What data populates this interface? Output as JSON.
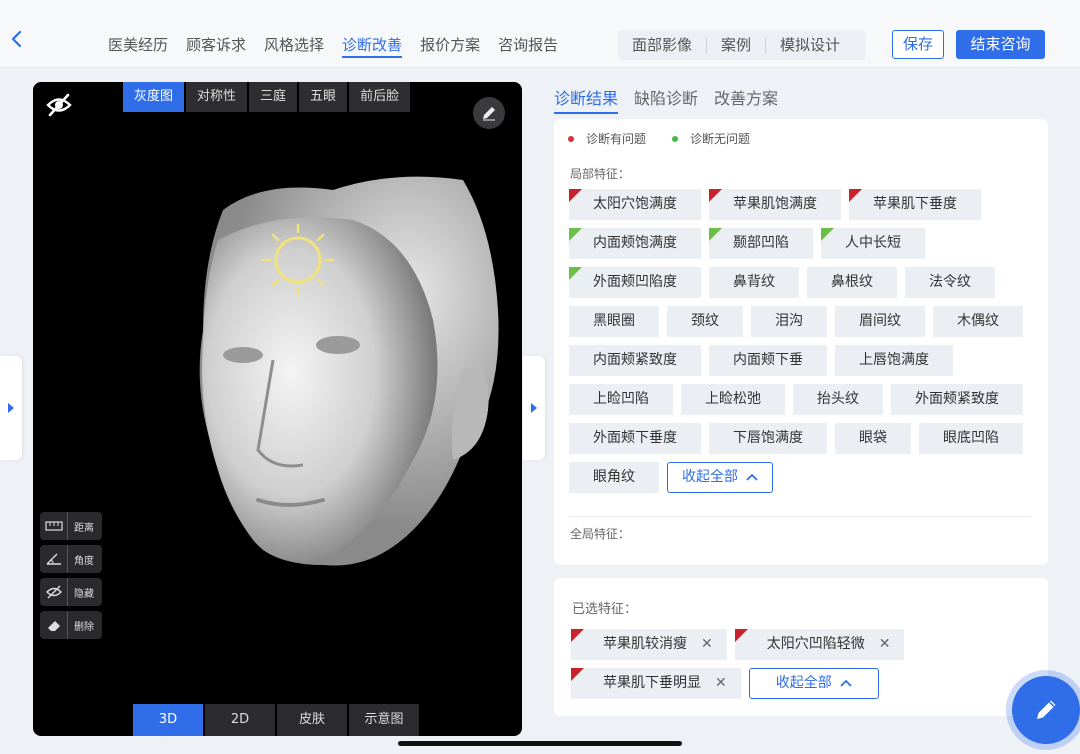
{
  "nav": {
    "tabs": [
      {
        "label": "医美经历"
      },
      {
        "label": "顾客诉求"
      },
      {
        "label": "风格选择"
      },
      {
        "label": "诊断改善"
      },
      {
        "label": "报价方案"
      },
      {
        "label": "咨询报告"
      }
    ],
    "active_tab": "诊断改善",
    "segments": [
      {
        "label": "面部影像"
      },
      {
        "label": "案例"
      },
      {
        "label": "模拟设计"
      }
    ],
    "save_label": "保存",
    "end_label": "结束咨询"
  },
  "viewer": {
    "view_tabs": [
      {
        "label": "灰度图"
      },
      {
        "label": "对称性"
      },
      {
        "label": "三庭"
      },
      {
        "label": "五眼"
      },
      {
        "label": "前后脸"
      }
    ],
    "active_view_tab": "灰度图",
    "tools": [
      {
        "label": "距离",
        "icon": "ruler-icon"
      },
      {
        "label": "角度",
        "icon": "angle-icon"
      },
      {
        "label": "隐藏",
        "icon": "hide-icon"
      },
      {
        "label": "删除",
        "icon": "eraser-icon"
      }
    ],
    "mode_tabs": [
      {
        "label": "3D"
      },
      {
        "label": "2D"
      },
      {
        "label": "皮肤"
      },
      {
        "label": "示意图"
      }
    ],
    "active_mode_tab": "3D"
  },
  "panel": {
    "tabs": [
      {
        "label": "诊断结果"
      },
      {
        "label": "缺陷诊断"
      },
      {
        "label": "改善方案"
      }
    ],
    "active_tab": "诊断结果",
    "legend": {
      "problem_label": "诊断有问题",
      "problem_color": "#d6303b",
      "ok_label": "诊断无问题",
      "ok_color": "#4cbb45"
    },
    "local_features_label": "局部特征：",
    "global_features_label": "全局特征：",
    "local_features": [
      {
        "label": "太阳穴饱满度",
        "flag": "red"
      },
      {
        "label": "苹果肌饱满度",
        "flag": "red"
      },
      {
        "label": "苹果肌下垂度",
        "flag": "red"
      },
      {
        "label": "内面颊饱满度",
        "flag": "green"
      },
      {
        "label": "颞部凹陷",
        "flag": "green"
      },
      {
        "label": "人中长短",
        "flag": "green"
      },
      {
        "label": "外面颊凹陷度",
        "flag": "green"
      },
      {
        "label": "鼻背纹",
        "flag": "none"
      },
      {
        "label": "鼻根纹",
        "flag": "none"
      },
      {
        "label": "法令纹",
        "flag": "none"
      },
      {
        "label": "黑眼圈",
        "flag": "none"
      },
      {
        "label": "颈纹",
        "flag": "none"
      },
      {
        "label": "泪沟",
        "flag": "none"
      },
      {
        "label": "眉间纹",
        "flag": "none"
      },
      {
        "label": "木偶纹",
        "flag": "none"
      },
      {
        "label": "内面颊紧致度",
        "flag": "none"
      },
      {
        "label": "内面颊下垂",
        "flag": "none"
      },
      {
        "label": "上唇饱满度",
        "flag": "none"
      },
      {
        "label": "上睑凹陷",
        "flag": "none"
      },
      {
        "label": "上睑松弛",
        "flag": "none"
      },
      {
        "label": "抬头纹",
        "flag": "none"
      },
      {
        "label": "外面颊紧致度",
        "flag": "none"
      },
      {
        "label": "外面颊下垂度",
        "flag": "none"
      },
      {
        "label": "下唇饱满度",
        "flag": "none"
      },
      {
        "label": "眼袋",
        "flag": "none"
      },
      {
        "label": "眼底凹陷",
        "flag": "none"
      },
      {
        "label": "眼角纹",
        "flag": "none"
      }
    ],
    "collapse_label": "收起全部",
    "selected_label": "已选特征：",
    "selected_features": [
      {
        "label": "苹果肌较消瘦"
      },
      {
        "label": "太阳穴凹陷轻微"
      },
      {
        "label": "苹果肌下垂明显"
      }
    ],
    "selected_collapse_label": "收起全部"
  }
}
